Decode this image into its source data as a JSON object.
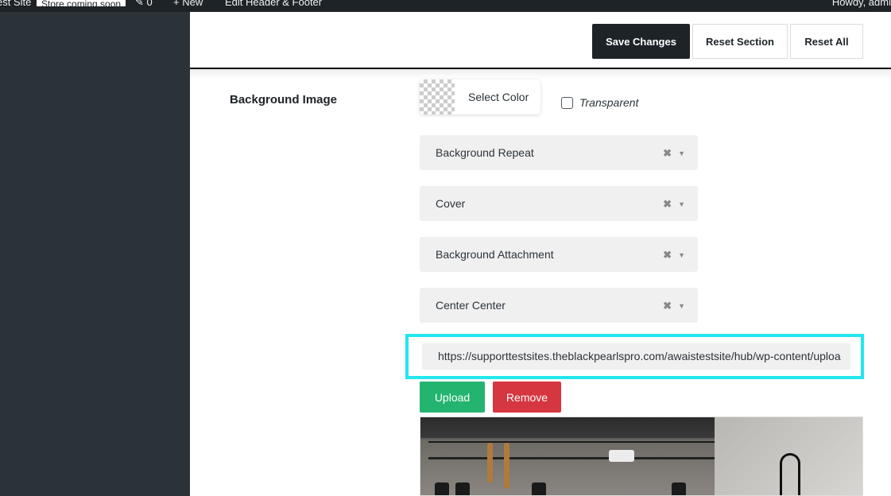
{
  "adminbar": {
    "site": "est Site",
    "badge": "Store coming soon",
    "comments_count": "0",
    "new_label": "New",
    "edit_label": "Edit Header & Footer",
    "howdy": "Howdy, admi"
  },
  "toolbar": {
    "save_label": "Save Changes",
    "reset_section_label": "Reset Section",
    "reset_all_label": "Reset All"
  },
  "section": {
    "label": "Background Image"
  },
  "color": {
    "select_label": "Select Color",
    "transparent_label": "Transparent"
  },
  "selects": [
    {
      "value": "Background Repeat"
    },
    {
      "value": "Cover"
    },
    {
      "value": "Background Attachment"
    },
    {
      "value": "Center Center"
    }
  ],
  "url": {
    "value": "https://supporttestsites.theblackpearlspro.com/awaistestsite/hub/wp-content/uploa"
  },
  "upload_label": "Upload",
  "remove_label": "Remove"
}
